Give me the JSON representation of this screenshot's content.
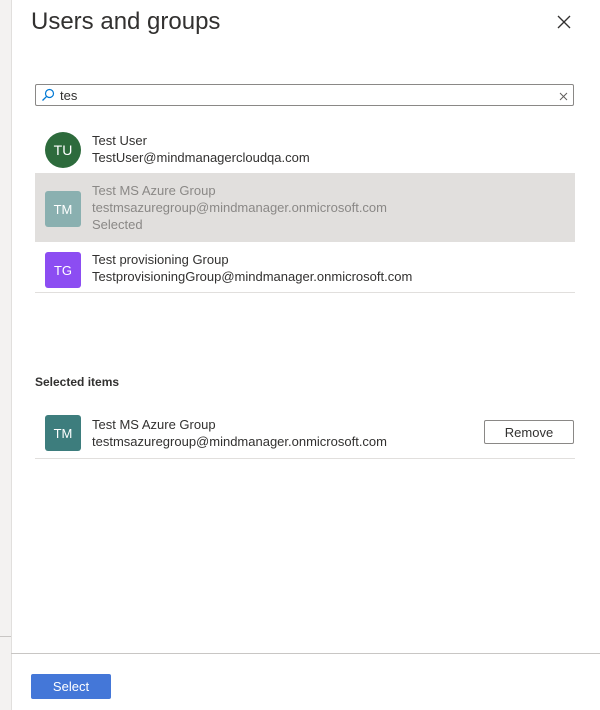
{
  "header": {
    "title": "Users and groups",
    "close_icon": "close-icon"
  },
  "search": {
    "value": "tes",
    "icon": "search-icon",
    "clear_icon": "clear-icon"
  },
  "results": [
    {
      "initials": "TU",
      "name": "Test User",
      "email": "TestUser@mindmanagercloudqa.com",
      "status": "",
      "avatar_color": "#2d6b3c",
      "selected": false
    },
    {
      "initials": "TM",
      "name": "Test MS Azure Group",
      "email": "testmsazuregroup@mindmanager.onmicrosoft.com",
      "status": "Selected",
      "avatar_color": "#8ab0b0",
      "selected": true
    },
    {
      "initials": "TG",
      "name": "Test provisioning Group",
      "email": "TestprovisioningGroup@mindmanager.onmicrosoft.com",
      "status": "",
      "avatar_color": "#8c4df2",
      "selected": false
    }
  ],
  "selected_section": {
    "title": "Selected items",
    "items": [
      {
        "initials": "TM",
        "name": "Test MS Azure Group",
        "email": "testmsazuregroup@mindmanager.onmicrosoft.com",
        "avatar_color": "#3d7d7d",
        "remove_label": "Remove"
      }
    ]
  },
  "footer": {
    "select_label": "Select",
    "select_color": "#4477d8"
  }
}
